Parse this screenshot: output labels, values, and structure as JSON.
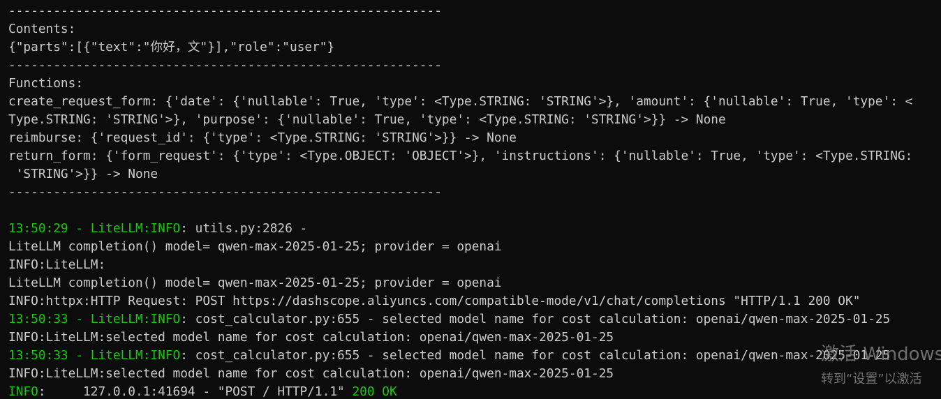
{
  "terminal": {
    "colors": {
      "background": "#0c0c0c",
      "text": "#cccccc",
      "green": "#16c60c"
    },
    "lines": [
      {
        "text": "----------------------------------------------------------"
      },
      {
        "text": "Contents:"
      },
      {
        "text": "{\"parts\":[{\"text\":\"你好，文\"}],\"role\":\"user\"}"
      },
      {
        "text": "----------------------------------------------------------"
      },
      {
        "text": "Functions:"
      },
      {
        "text": "create_request_form: {'date': {'nullable': True, 'type': <Type.STRING: 'STRING'>}, 'amount': {'nullable': True, 'type': <"
      },
      {
        "text": "Type.STRING: 'STRING'>}, 'purpose': {'nullable': True, 'type': <Type.STRING: 'STRING'>}} -> None"
      },
      {
        "text": "reimburse: {'request_id': {'type': <Type.STRING: 'STRING'>}} -> None"
      },
      {
        "text": "return_form: {'form_request': {'type': <Type.OBJECT: 'OBJECT'>}, 'instructions': {'nullable': True, 'type': <Type.STRING:"
      },
      {
        "text": " 'STRING'>}} -> None"
      },
      {
        "text": "----------------------------------------------------------"
      },
      {
        "text": ""
      },
      {
        "green": "13:50:29 - LiteLLM:INFO",
        "text": ": utils.py:2826 -"
      },
      {
        "text": "LiteLLM completion() model= qwen-max-2025-01-25; provider = openai"
      },
      {
        "text": "INFO:LiteLLM:"
      },
      {
        "text": "LiteLLM completion() model= qwen-max-2025-01-25; provider = openai"
      },
      {
        "text": "INFO:httpx:HTTP Request: POST https://dashscope.aliyuncs.com/compatible-mode/v1/chat/completions \"HTTP/1.1 200 OK\""
      },
      {
        "green": "13:50:33 - LiteLLM:INFO",
        "text": ": cost_calculator.py:655 - selected model name for cost calculation: openai/qwen-max-2025-01-25"
      },
      {
        "text": "INFO:LiteLLM:selected model name for cost calculation: openai/qwen-max-2025-01-25"
      },
      {
        "green": "13:50:33 - LiteLLM:INFO",
        "text": ": cost_calculator.py:655 - selected model name for cost calculation: openai/qwen-max-2025-01-25"
      },
      {
        "text": "INFO:LiteLLM:selected model name for cost calculation: openai/qwen-max-2025-01-25"
      },
      {
        "green": "INFO",
        "text": ":     127.0.0.1:41694 - \"POST / HTTP/1.1\" ",
        "green2": "200 OK"
      }
    ]
  },
  "watermark": {
    "line1": "激活 Windows",
    "line2": "转到“设置”以激活"
  }
}
